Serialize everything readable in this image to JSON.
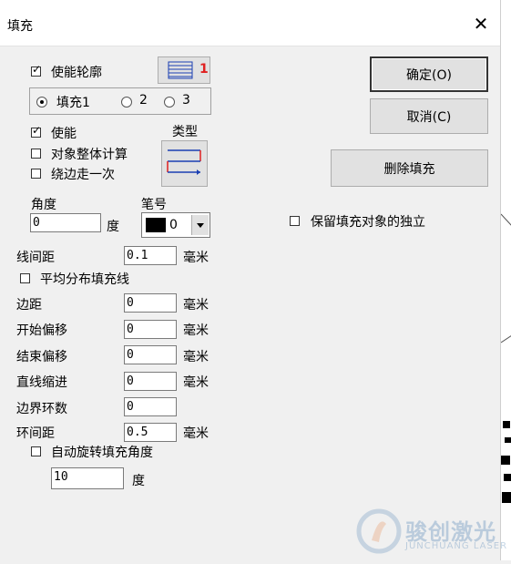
{
  "window": {
    "title": "填充",
    "close_glyph": "✕"
  },
  "contour": {
    "enable_label": "使能轮廓",
    "enable_checked": true,
    "pen_button_badge": "1"
  },
  "fill_mode": {
    "options": [
      {
        "label": "填充1",
        "selected": true
      },
      {
        "label": "2",
        "selected": false
      },
      {
        "label": "3",
        "selected": false
      }
    ]
  },
  "fill": {
    "enable_label": "使能",
    "enable_checked": true,
    "whole_calc_label": "对象整体计算",
    "whole_calc_checked": false,
    "edge_once_label": "绕边走一次",
    "edge_once_checked": false,
    "type_label": "类型"
  },
  "angle": {
    "label": "角度",
    "value": "0",
    "unit": "度"
  },
  "pen": {
    "label": "笔号",
    "value": "0",
    "color": "#000000"
  },
  "line_spacing": {
    "label": "线间距",
    "value": "0.1",
    "unit": "毫米"
  },
  "even_dist": {
    "label": "平均分布填充线",
    "checked": false
  },
  "margin": {
    "label": "边距",
    "value": "0",
    "unit": "毫米"
  },
  "start_offset": {
    "label": "开始偏移",
    "value": "0",
    "unit": "毫米"
  },
  "end_offset": {
    "label": "结束偏移",
    "value": "0",
    "unit": "毫米"
  },
  "line_indent": {
    "label": "直线缩进",
    "value": "0",
    "unit": "毫米"
  },
  "border_loops": {
    "label": "边界环数",
    "value": "0"
  },
  "loop_spacing": {
    "label": "环间距",
    "value": "0.5",
    "unit": "毫米"
  },
  "auto_rotate": {
    "label": "自动旋转填充角度",
    "checked": false,
    "value": "10",
    "unit": "度"
  },
  "keep_independent": {
    "label": "保留填充对象的独立",
    "checked": false
  },
  "buttons": {
    "ok": "确定(O)",
    "cancel": "取消(C)",
    "delete_fill": "删除填充"
  },
  "watermark": {
    "brand": "骏创激光",
    "sub": "JUNCHUANG LASER"
  },
  "colors": {
    "accent_red": "#e02020",
    "accent_blue": "#1a3fb3"
  }
}
